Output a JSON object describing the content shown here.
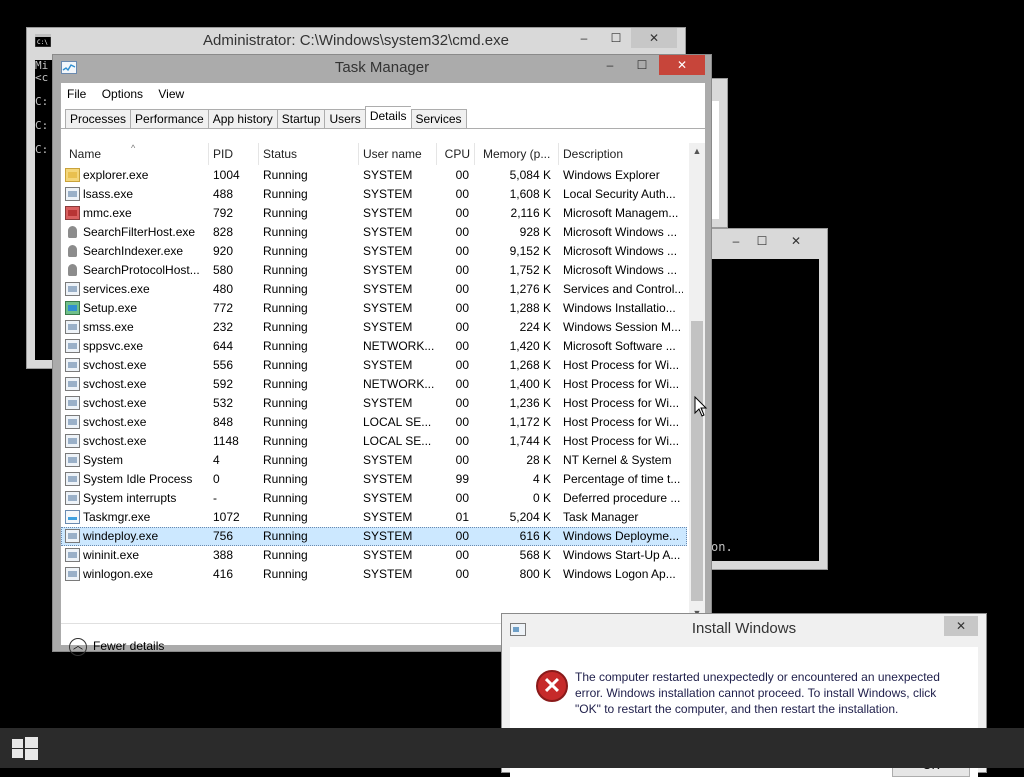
{
  "cmd_window": {
    "title": "Administrator: C:\\Windows\\system32\\cmd.exe",
    "icon": "cmd-icon",
    "minimize": "–",
    "maximize": "☐",
    "close": "✕",
    "console_lines": [
      "Mi",
      "<c",
      "",
      "C:",
      "",
      "C:",
      "",
      "C:"
    ]
  },
  "bg_window": {
    "minimize": "–",
    "maximize": "☐",
    "close": "✕",
    "console_text": "on."
  },
  "task_manager": {
    "title": "Task Manager",
    "icon": "task-manager-icon",
    "minimize": "–",
    "maximize": "☐",
    "close": "✕",
    "menu": [
      "File",
      "Options",
      "View"
    ],
    "tabs": [
      "Processes",
      "Performance",
      "App history",
      "Startup",
      "Users",
      "Details",
      "Services"
    ],
    "active_tab": "Details",
    "columns": [
      "Name",
      "PID",
      "Status",
      "User name",
      "CPU",
      "Memory (p...",
      "Description"
    ],
    "rows": [
      {
        "icon": "folder-icon",
        "name": "explorer.exe",
        "pid": "1004",
        "status": "Running",
        "user": "SYSTEM",
        "cpu": "00",
        "mem": "5,084 K",
        "desc": "Windows Explorer"
      },
      {
        "icon": "process-icon",
        "name": "lsass.exe",
        "pid": "488",
        "status": "Running",
        "user": "SYSTEM",
        "cpu": "00",
        "mem": "1,608 K",
        "desc": "Local Security Auth..."
      },
      {
        "icon": "mmc-icon",
        "name": "mmc.exe",
        "pid": "792",
        "status": "Running",
        "user": "SYSTEM",
        "cpu": "00",
        "mem": "2,116 K",
        "desc": "Microsoft Managem..."
      },
      {
        "icon": "user-icon",
        "name": "SearchFilterHost.exe",
        "pid": "828",
        "status": "Running",
        "user": "SYSTEM",
        "cpu": "00",
        "mem": "928 K",
        "desc": "Microsoft Windows ..."
      },
      {
        "icon": "user-icon",
        "name": "SearchIndexer.exe",
        "pid": "920",
        "status": "Running",
        "user": "SYSTEM",
        "cpu": "00",
        "mem": "9,152 K",
        "desc": "Microsoft Windows ..."
      },
      {
        "icon": "user-icon",
        "name": "SearchProtocolHost...",
        "pid": "580",
        "status": "Running",
        "user": "SYSTEM",
        "cpu": "00",
        "mem": "1,752 K",
        "desc": "Microsoft Windows ..."
      },
      {
        "icon": "process-icon",
        "name": "services.exe",
        "pid": "480",
        "status": "Running",
        "user": "SYSTEM",
        "cpu": "00",
        "mem": "1,276 K",
        "desc": "Services and Control..."
      },
      {
        "icon": "setup-icon",
        "name": "Setup.exe",
        "pid": "772",
        "status": "Running",
        "user": "SYSTEM",
        "cpu": "00",
        "mem": "1,288 K",
        "desc": "Windows Installatio..."
      },
      {
        "icon": "process-icon",
        "name": "smss.exe",
        "pid": "232",
        "status": "Running",
        "user": "SYSTEM",
        "cpu": "00",
        "mem": "224 K",
        "desc": "Windows Session M..."
      },
      {
        "icon": "process-icon",
        "name": "sppsvc.exe",
        "pid": "644",
        "status": "Running",
        "user": "NETWORK...",
        "cpu": "00",
        "mem": "1,420 K",
        "desc": "Microsoft Software ..."
      },
      {
        "icon": "process-icon",
        "name": "svchost.exe",
        "pid": "556",
        "status": "Running",
        "user": "SYSTEM",
        "cpu": "00",
        "mem": "1,268 K",
        "desc": "Host Process for Wi..."
      },
      {
        "icon": "process-icon",
        "name": "svchost.exe",
        "pid": "592",
        "status": "Running",
        "user": "NETWORK...",
        "cpu": "00",
        "mem": "1,400 K",
        "desc": "Host Process for Wi..."
      },
      {
        "icon": "process-icon",
        "name": "svchost.exe",
        "pid": "532",
        "status": "Running",
        "user": "SYSTEM",
        "cpu": "00",
        "mem": "1,236 K",
        "desc": "Host Process for Wi..."
      },
      {
        "icon": "process-icon",
        "name": "svchost.exe",
        "pid": "848",
        "status": "Running",
        "user": "LOCAL SE...",
        "cpu": "00",
        "mem": "1,172 K",
        "desc": "Host Process for Wi..."
      },
      {
        "icon": "process-icon",
        "name": "svchost.exe",
        "pid": "1148",
        "status": "Running",
        "user": "LOCAL SE...",
        "cpu": "00",
        "mem": "1,744 K",
        "desc": "Host Process for Wi..."
      },
      {
        "icon": "process-icon",
        "name": "System",
        "pid": "4",
        "status": "Running",
        "user": "SYSTEM",
        "cpu": "00",
        "mem": "28 K",
        "desc": "NT Kernel & System"
      },
      {
        "icon": "process-icon",
        "name": "System Idle Process",
        "pid": "0",
        "status": "Running",
        "user": "SYSTEM",
        "cpu": "99",
        "mem": "4 K",
        "desc": "Percentage of time t..."
      },
      {
        "icon": "process-icon",
        "name": "System interrupts",
        "pid": "-",
        "status": "Running",
        "user": "SYSTEM",
        "cpu": "00",
        "mem": "0 K",
        "desc": "Deferred procedure ..."
      },
      {
        "icon": "task-manager-icon",
        "name": "Taskmgr.exe",
        "pid": "1072",
        "status": "Running",
        "user": "SYSTEM",
        "cpu": "01",
        "mem": "5,204 K",
        "desc": "Task Manager"
      },
      {
        "icon": "process-icon",
        "name": "windeploy.exe",
        "pid": "756",
        "status": "Running",
        "user": "SYSTEM",
        "cpu": "00",
        "mem": "616 K",
        "desc": "Windows Deployme...",
        "selected": true
      },
      {
        "icon": "process-icon",
        "name": "wininit.exe",
        "pid": "388",
        "status": "Running",
        "user": "SYSTEM",
        "cpu": "00",
        "mem": "568 K",
        "desc": "Windows Start-Up A..."
      },
      {
        "icon": "process-icon",
        "name": "winlogon.exe",
        "pid": "416",
        "status": "Running",
        "user": "SYSTEM",
        "cpu": "00",
        "mem": "800 K",
        "desc": "Windows Logon Ap..."
      }
    ],
    "fewer_details": "Fewer details",
    "fewer_icon": "chevron-up-circle-icon"
  },
  "install_dialog": {
    "title": "Install Windows",
    "close": "✕",
    "icon": "error-icon",
    "message": "The computer restarted unexpectedly or encountered an unexpected error. Windows installation cannot proceed. To install Windows, click \"OK\" to restart the computer, and then restart the installation.",
    "ok_label": "OK"
  },
  "taskbar": {
    "start_icon": "windows-logo-icon"
  }
}
